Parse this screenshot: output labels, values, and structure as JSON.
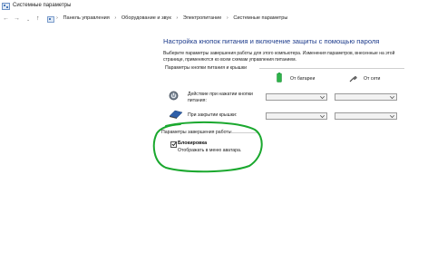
{
  "window": {
    "title": "Системные параметры"
  },
  "address": {
    "crumbs": [
      "Панель управления",
      "Оборудование и звук",
      "Электропитание",
      "Системные параметры"
    ]
  },
  "main": {
    "heading": "Настройка кнопок питания и включение защиты с помощью пароля",
    "description": "Выберите параметры завершения работы для этого компьютера. Изменения параметров, внесенные на этой странице, применяются ко всем схемам управления питанием.",
    "buttons_section_title": "Параметры кнопки питания и крышки",
    "columns": {
      "battery": "От батареи",
      "plugged": "От сети"
    },
    "rows": [
      {
        "label": "Действие при нажатии кнопки питания:",
        "battery_value": "",
        "plugged_value": ""
      },
      {
        "label": "При закрытии крышки:",
        "battery_value": "",
        "plugged_value": ""
      }
    ],
    "shutdown_section_title": "Параметры завершения работы",
    "lock": {
      "label": "Блокировка",
      "hint": "Отображать в меню аватара.",
      "checked": true
    }
  },
  "colors": {
    "heading": "#1e3c8c",
    "annotation": "#1aa82e",
    "battery": "#2db34a"
  },
  "icons": {
    "app": "control-panel-icon",
    "back": "back-arrow-icon",
    "forward": "forward-arrow-icon",
    "up": "up-arrow-icon",
    "power_button": "power-button-icon",
    "lid": "laptop-lid-icon",
    "battery": "battery-icon",
    "plug": "plug-icon"
  }
}
